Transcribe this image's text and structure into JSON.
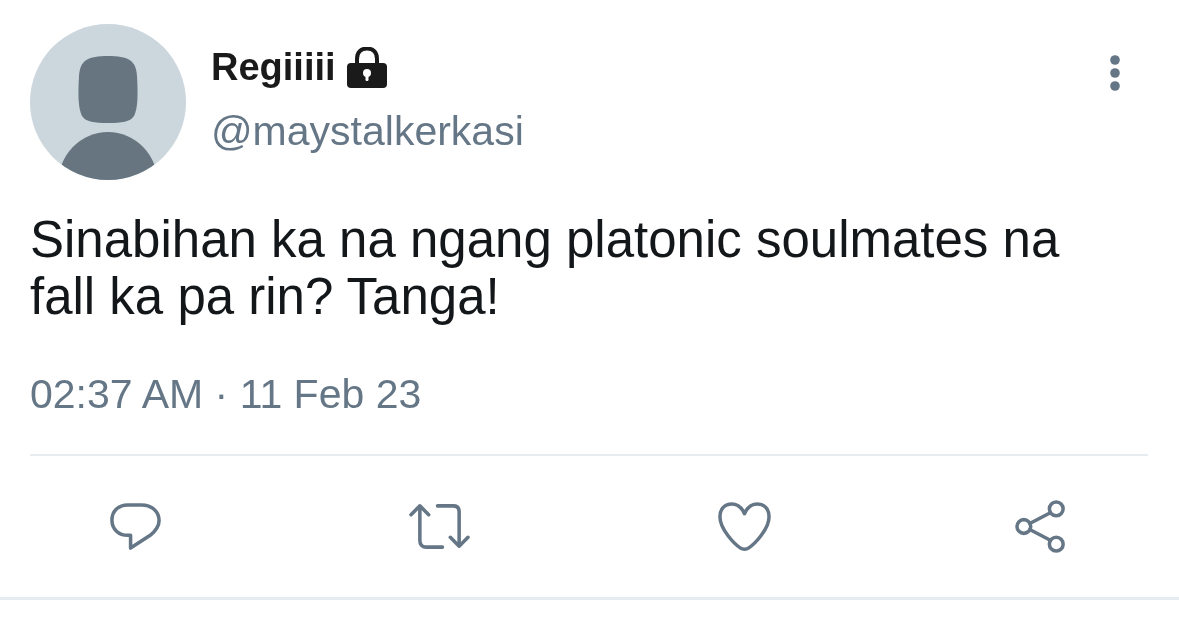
{
  "author": {
    "name": "Regiiiii",
    "protected": true,
    "handle": "@maystalkerkasi"
  },
  "tweet": {
    "text": "Sinabihan ka na ngang platonic soulmates na fall ka pa rin? Tanga!",
    "timestamp": "02:37 AM · 11 Feb 23"
  },
  "actions": [
    {
      "kind": "reply"
    },
    {
      "kind": "retweet"
    },
    {
      "kind": "like"
    },
    {
      "kind": "share"
    }
  ]
}
